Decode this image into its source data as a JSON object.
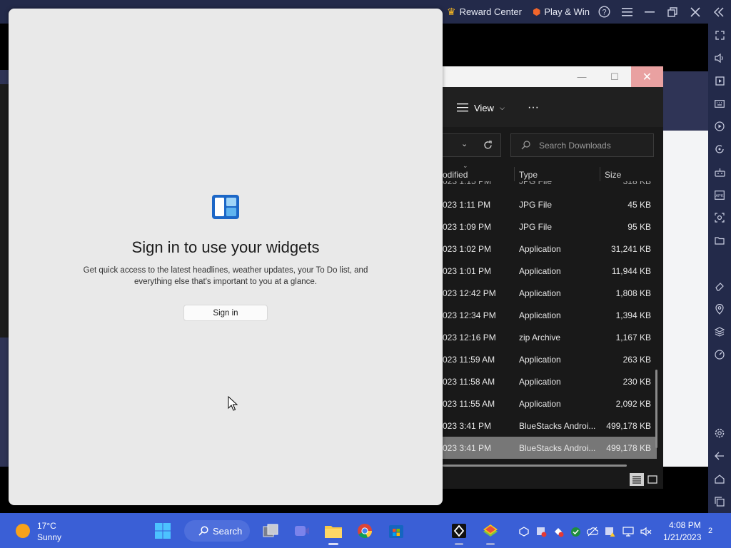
{
  "bluestacks": {
    "reward_center": "Reward Center",
    "play_win": "Play & Win",
    "colors": {
      "bar": "#232a4a",
      "accent_gold": "#f5b623",
      "accent_orange": "#f2662b"
    },
    "icons": [
      "crown-icon",
      "coin-icon",
      "help-icon",
      "menu-icon",
      "minimize-icon",
      "restore-icon",
      "close-icon",
      "collapse-sidebar-icon"
    ],
    "sidebar_icons": [
      "fullscreen-icon",
      "volume-icon",
      "media-manager-icon",
      "keyboard-icon",
      "macro-icon",
      "rotate-icon",
      "game-controls-icon",
      "apk-icon",
      "screenshot-icon",
      "folder-icon",
      "eraser-icon",
      "location-icon",
      "layers-icon",
      "performance-icon",
      "settings-icon",
      "back-icon",
      "home-icon",
      "recent-apps-icon"
    ]
  },
  "explorer": {
    "view_label": "View",
    "more_label": "···",
    "search_placeholder": "Search Downloads",
    "columns": {
      "date": "odified",
      "type": "Type",
      "size": "Size"
    },
    "partial_row": {
      "date": "023 1:15 PM",
      "type": "JPG File",
      "size": "318 KB"
    },
    "rows": [
      {
        "date": "023 1:11 PM",
        "type": "JPG File",
        "size": "45 KB"
      },
      {
        "date": "023 1:09 PM",
        "type": "JPG File",
        "size": "95 KB"
      },
      {
        "date": "023 1:02 PM",
        "type": "Application",
        "size": "31,241 KB"
      },
      {
        "date": "023 1:01 PM",
        "type": "Application",
        "size": "11,944 KB"
      },
      {
        "date": "023 12:42 PM",
        "type": "Application",
        "size": "1,808 KB"
      },
      {
        "date": "023 12:34 PM",
        "type": "Application",
        "size": "1,394 KB"
      },
      {
        "date": "023 12:16 PM",
        "type": "zip Archive",
        "size": "1,167 KB"
      },
      {
        "date": "023 11:59 AM",
        "type": "Application",
        "size": "263 KB"
      },
      {
        "date": "023 11:58 AM",
        "type": "Application",
        "size": "230 KB"
      },
      {
        "date": "023 11:55 AM",
        "type": "Application",
        "size": "2,092 KB"
      },
      {
        "date": "023 3:41 PM",
        "type": "BlueStacks Androi...",
        "size": "499,178 KB"
      },
      {
        "date": "023 3:41 PM",
        "type": "BlueStacks Androi...",
        "size": "499,178 KB",
        "selected": true
      }
    ]
  },
  "widgets": {
    "title": "Sign in to use your widgets",
    "description": "Get quick access to the latest headlines, weather updates, your To Do list, and everything else that's important to you at a glance.",
    "button": "Sign in"
  },
  "taskbar": {
    "weather_temp": "17°C",
    "weather_desc": "Sunny",
    "search_label": "Search",
    "time": "4:08 PM",
    "date": "1/21/2023",
    "notification_count": "2",
    "color": "#3a5fd6"
  }
}
